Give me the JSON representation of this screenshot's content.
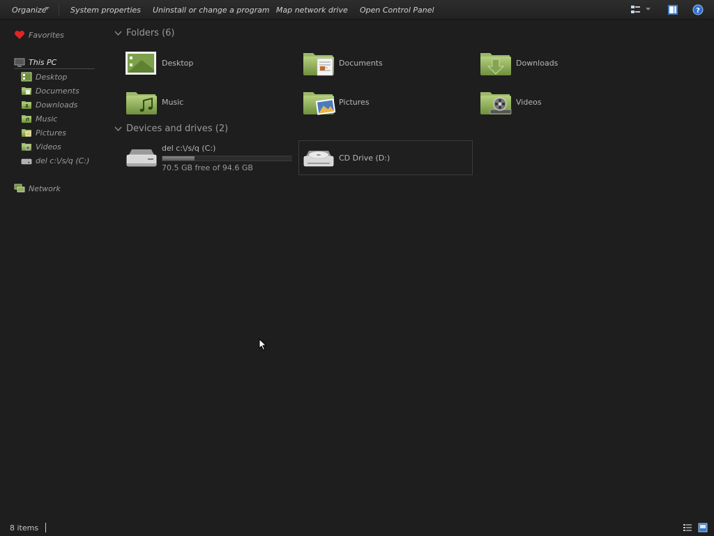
{
  "toolbar": {
    "organize": "Organize",
    "system_properties": "System properties",
    "uninstall": "Uninstall or change a program",
    "map_drive": "Map network drive",
    "control_panel": "Open Control Panel",
    "icons": [
      "view-options-icon",
      "preview-pane-icon",
      "help-icon"
    ]
  },
  "nav": {
    "favorites": "Favorites",
    "this_pc": "This PC",
    "items": [
      {
        "label": "Desktop",
        "icon": "desktop-icon"
      },
      {
        "label": "Documents",
        "icon": "documents-folder-icon"
      },
      {
        "label": "Downloads",
        "icon": "downloads-folder-icon"
      },
      {
        "label": "Music",
        "icon": "music-folder-icon"
      },
      {
        "label": "Pictures",
        "icon": "pictures-folder-icon"
      },
      {
        "label": "Videos",
        "icon": "videos-folder-icon"
      },
      {
        "label": "del c:\\/s/q (C:)",
        "icon": "drive-icon"
      }
    ],
    "network": "Network"
  },
  "folders": {
    "header": "Folders (6)",
    "items": [
      {
        "label": "Desktop",
        "icon": "desktop-folder-icon"
      },
      {
        "label": "Documents",
        "icon": "documents-folder-icon"
      },
      {
        "label": "Downloads",
        "icon": "downloads-folder-icon"
      },
      {
        "label": "Music",
        "icon": "music-folder-icon"
      },
      {
        "label": "Pictures",
        "icon": "pictures-folder-icon"
      },
      {
        "label": "Videos",
        "icon": "videos-folder-icon"
      }
    ]
  },
  "drives": {
    "header": "Devices and drives (2)",
    "c": {
      "name": "del c:\\/s/q (C:)",
      "free_text": "70.5 GB free of 94.6 GB",
      "used_fraction": 0.25
    },
    "d": {
      "name": "CD Drive (D:)"
    }
  },
  "status": {
    "items": "8 items"
  },
  "colors": {
    "background": "#1e1e1e",
    "folder_green": "#8fae5c",
    "text": "#b8b8b8"
  }
}
